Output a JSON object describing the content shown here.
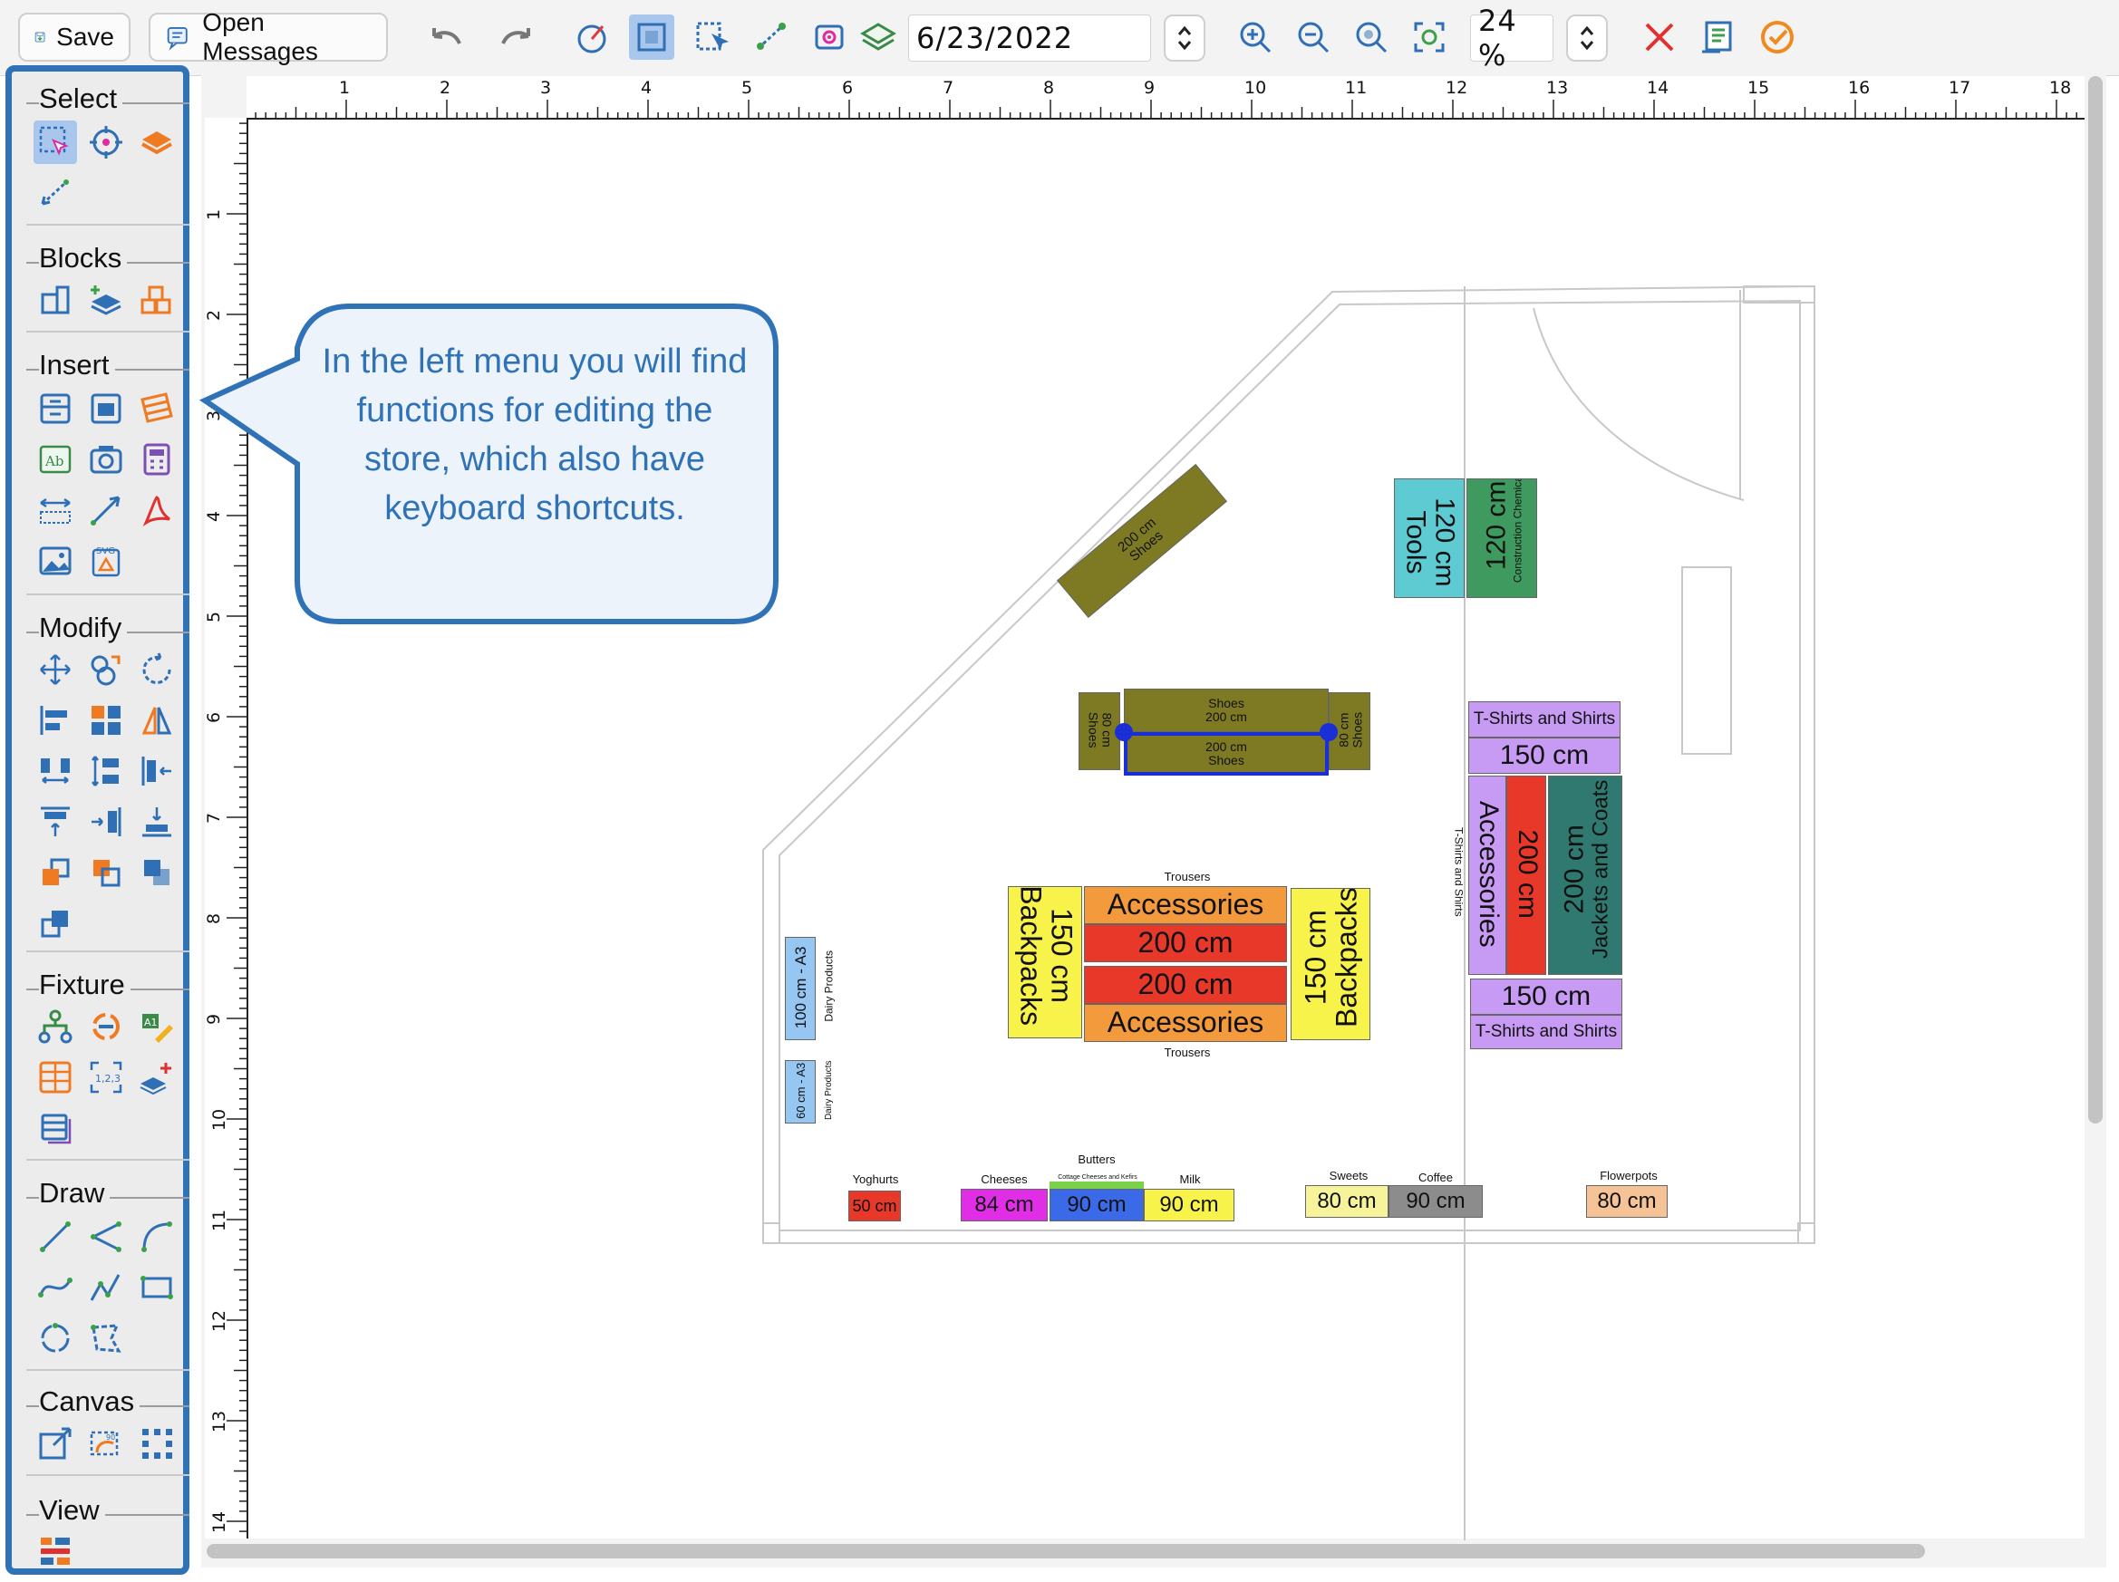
{
  "toolbar": {
    "save_label": "Save",
    "open_messages_label": "Open Messages",
    "date_value": "6/23/2022",
    "zoom_value": "24 %"
  },
  "left_panel": {
    "sections": [
      {
        "title": "Select"
      },
      {
        "title": "Blocks"
      },
      {
        "title": "Insert"
      },
      {
        "title": "Modify"
      },
      {
        "title": "Fixture"
      },
      {
        "title": "Draw"
      },
      {
        "title": "Canvas"
      },
      {
        "title": "View"
      }
    ]
  },
  "callout": {
    "text": "In the left menu you will find functions for editing the store, which also have keyboard shortcuts."
  },
  "rulers": {
    "top": [
      "1",
      "2",
      "3",
      "4",
      "5",
      "6",
      "7",
      "8",
      "9",
      "10",
      "11",
      "12",
      "13",
      "14",
      "15",
      "16",
      "17",
      "18"
    ],
    "left": [
      "1",
      "2",
      "3",
      "4",
      "5",
      "6",
      "7",
      "8",
      "9",
      "10",
      "11",
      "12",
      "13",
      "14"
    ]
  },
  "fixtures": {
    "shoes_diag": {
      "size": "200 cm",
      "name": "Shoes"
    },
    "tools": {
      "size": "120 cm",
      "name": "Tools"
    },
    "construction": {
      "size": "120 cm",
      "name": "Construction Chemicals"
    },
    "shoes_top": {
      "name": "Shoes",
      "size": "200 cm"
    },
    "shoes_bottom": {
      "size": "200 cm",
      "name": "Shoes"
    },
    "shoes_left": {
      "size": "80 cm",
      "name": "Shoes"
    },
    "shoes_right": {
      "size": "80 cm",
      "name": "Shoes"
    },
    "tshirts_top": {
      "name": "T-Shirts and Shirts",
      "size": "150 cm"
    },
    "accessories_v": {
      "name": "Accessories"
    },
    "red_200_v": {
      "size": "200 cm"
    },
    "jackets": {
      "size": "200 cm",
      "name": "Jackets and Coats"
    },
    "tshirts_side": {
      "name": "T-Shirts and Shirts"
    },
    "tshirts_bottom": {
      "size": "150 cm",
      "name": "T-Shirts and Shirts"
    },
    "trousers_top": {
      "name": "Trousers"
    },
    "acc_top": {
      "name": "Accessories"
    },
    "red1": {
      "size": "200 cm"
    },
    "red2": {
      "size": "200 cm"
    },
    "acc_bottom": {
      "name": "Accessories"
    },
    "trousers_bottom": {
      "name": "Trousers"
    },
    "backpacks_left": {
      "size": "150 cm",
      "name": "Backpacks"
    },
    "backpacks_right": {
      "size": "150 cm",
      "name": "Backpacks"
    },
    "dairy1": {
      "size": "100 cm - A3",
      "name": "Dairy Products"
    },
    "dairy2": {
      "size": "60 cm - A3",
      "name": "Dairy Products"
    },
    "yoghurts": {
      "name": "Yoghurts",
      "size": "50 cm"
    },
    "cheeses": {
      "name": "Cheeses",
      "size": "84 cm"
    },
    "butters": {
      "name": "Butters",
      "sub": "Cottage Cheeses and Kefirs",
      "size": "90 cm"
    },
    "milk": {
      "name": "Milk",
      "size": "90 cm"
    },
    "sweets": {
      "name": "Sweets",
      "size": "80 cm"
    },
    "coffee": {
      "name": "Coffee",
      "size": "90 cm"
    },
    "flowerpots": {
      "name": "Flowerpots",
      "size": "80 cm"
    }
  },
  "colors": {
    "panel_border": "#2f72b8",
    "olive": "#7d7a23",
    "cyan": "#5ecbd3",
    "green": "#3e9a5e",
    "violet": "#c79af3",
    "red": "#e8382a",
    "teal": "#2f7970",
    "orange": "#f29a3c",
    "yellow": "#f8f34b",
    "lightblue": "#96c6f2",
    "magenta": "#e12ee6",
    "blue": "#3b6ae8",
    "lime": "#7bd14a",
    "lightyellow": "#f7f39b",
    "grey": "#8c8c8c",
    "peach": "#f5c396"
  }
}
